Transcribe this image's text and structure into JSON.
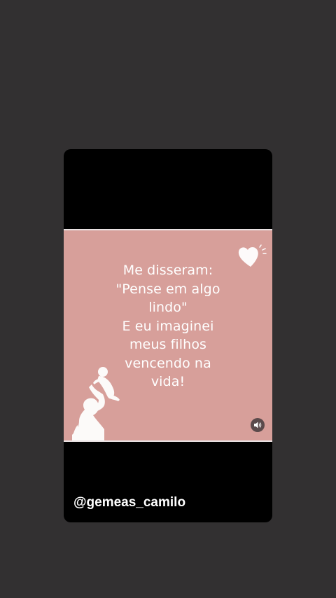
{
  "story": {
    "quote_lines": [
      "Me disseram:",
      "\"Pense em algo",
      "lindo\"",
      "E eu imaginei",
      "meus filhos",
      "vencendo na",
      "vida!"
    ],
    "username": "@gemeas_camilo",
    "icons": {
      "decoration": "heart-icon",
      "illustration": "mother-baby-silhouette-icon",
      "audio": "volume-icon"
    }
  },
  "colors": {
    "page_background": "#323031",
    "card_background": "#000000",
    "video_background": "#d79f9a",
    "text": "#ffffff"
  }
}
